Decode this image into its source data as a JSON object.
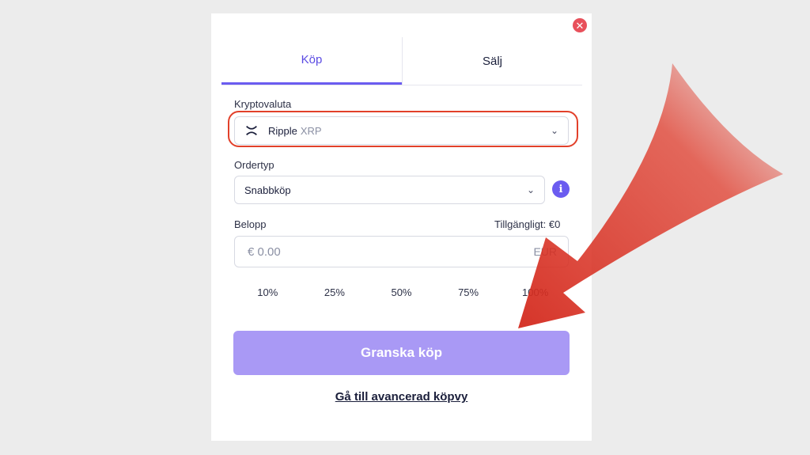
{
  "modal": {
    "close_icon": "close-icon"
  },
  "tabs": [
    {
      "label": "Köp",
      "active": true
    },
    {
      "label": "Sälj",
      "active": false
    }
  ],
  "crypto": {
    "label": "Kryptovaluta",
    "selected_name": "Ripple",
    "selected_ticker": "XRP",
    "icon": "xrp-icon"
  },
  "order": {
    "label": "Ordertyp",
    "selected": "Snabbköp"
  },
  "amount": {
    "label": "Belopp",
    "available": "Tillgängligt: €0",
    "placeholder": "€ 0.00",
    "currency": "EUR"
  },
  "percentages": [
    "10%",
    "25%",
    "50%",
    "75%",
    "100%"
  ],
  "actions": {
    "review_button": "Granska köp",
    "advanced_link": "Gå till avancerad köpvy"
  },
  "colors": {
    "accent": "#6b5cf0",
    "button": "#a999f5",
    "highlight": "#e2402a",
    "arrow": "#e03a2a"
  }
}
